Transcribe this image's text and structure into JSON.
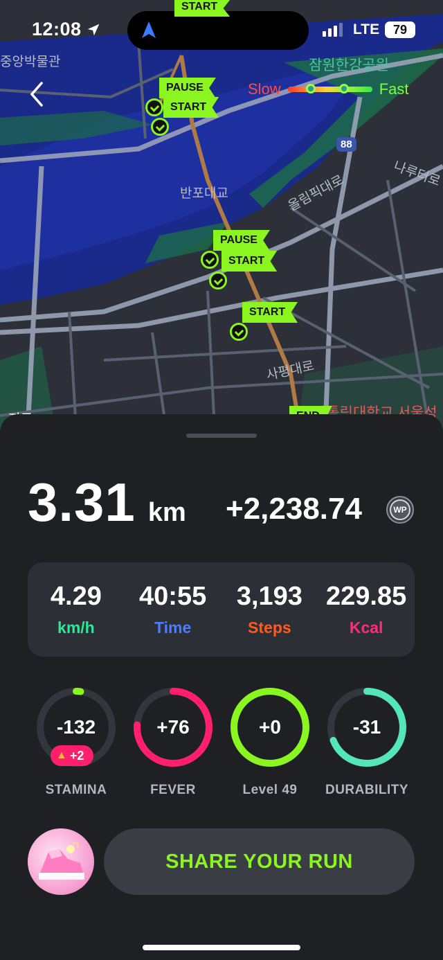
{
  "status": {
    "time": "12:08",
    "network": "LTE",
    "battery": "79"
  },
  "map": {
    "legend": {
      "slow": "Slow",
      "fast": "Fast"
    },
    "labels": {
      "museum": "중앙박물관",
      "park": "잠원한강공원",
      "bridge": "반포대교",
      "road_a": "올림픽대로",
      "road_b": "나루터로",
      "road_c": "사평대로",
      "univ": "가톨릭대학교 서울성",
      "partial_left": "지도",
      "route_no": "88"
    },
    "flags": {
      "top_start": "START",
      "pause_1": "PAUSE",
      "start_1": "START",
      "pause_2": "PAUSE",
      "start_2": "START",
      "start_3": "START",
      "end": "END"
    }
  },
  "summary": {
    "distance_value": "3.31",
    "distance_unit": "km",
    "wp_earned": "+2,238.74",
    "wp_badge": "WP"
  },
  "stats": [
    {
      "value": "4.29",
      "label": "km/h",
      "color": "#2ee89a"
    },
    {
      "value": "40:55",
      "label": "Time",
      "color": "#4a7dff"
    },
    {
      "value": "3,193",
      "label": "Steps",
      "color": "#ff5a1f"
    },
    {
      "value": "229.85",
      "label": "Kcal",
      "color": "#ff2d78"
    }
  ],
  "gauges": [
    {
      "value": "-132",
      "label": "STAMINA",
      "color": "#8af51f",
      "fill": 0.02,
      "bonus": "+2"
    },
    {
      "value": "+76",
      "label": "FEVER",
      "color": "#ff1f6b",
      "fill": 0.76
    },
    {
      "value": "+0",
      "label": "Level 49",
      "color": "#8af51f",
      "fill": 1.0
    },
    {
      "value": "-31",
      "label": "DURABILITY",
      "color": "#55e6b8",
      "fill": 0.69
    }
  ],
  "share_label": "SHARE YOUR RUN"
}
